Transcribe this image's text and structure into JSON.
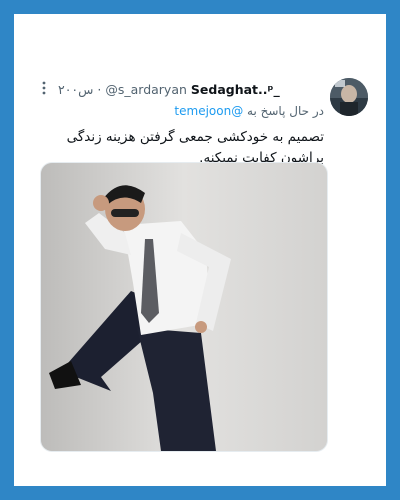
{
  "tweet": {
    "display_name": "Sedaghat..ᵖ_",
    "handle": "@s_ardaryan",
    "time": "۲۰۰س",
    "reply_prefix": "در حال پاسخ به",
    "reply_to": "@temejoon",
    "text": "تصمیم به خودکشی جمعی گرفتن هزینه زندگی براشون کفایت نمیکنه.",
    "media_description": "photo-man-in-white-shirt-and-tie-posing-against-wall"
  },
  "colors": {
    "frame": "#2f86c6",
    "card": "#ffffff",
    "mention": "#1d9bf0",
    "secondary_text": "#536471",
    "primary_text": "#0f1419"
  },
  "icons": {
    "more": "more-vertical-icon"
  }
}
